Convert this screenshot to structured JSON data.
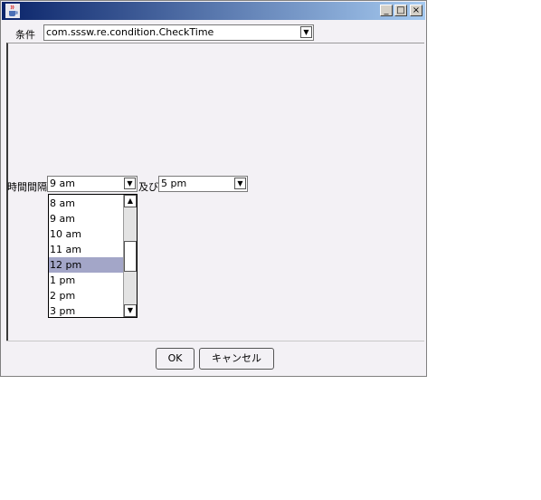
{
  "window": {
    "minimize_glyph": "_",
    "maximize_glyph": "□",
    "close_glyph": "×"
  },
  "condition": {
    "label": "条件",
    "selected": "com.sssw.re.condition.CheckTime"
  },
  "time_range": {
    "label": "時間間隔",
    "start_value": "9 am",
    "and_label": "及び",
    "end_value": "5 pm"
  },
  "dropdown": {
    "options": [
      "8 am",
      "9 am",
      "10 am",
      "11 am",
      "12 pm",
      "1 pm",
      "2 pm",
      "3 pm"
    ],
    "highlighted": "12 pm"
  },
  "buttons": {
    "ok": "OK",
    "cancel": "キャンセル"
  },
  "icons": {
    "app": "java-coffee-cup-icon",
    "combo_arrow": "chevron-down-icon",
    "scroll_up": "chevron-up-icon",
    "scroll_down": "chevron-down-icon"
  }
}
